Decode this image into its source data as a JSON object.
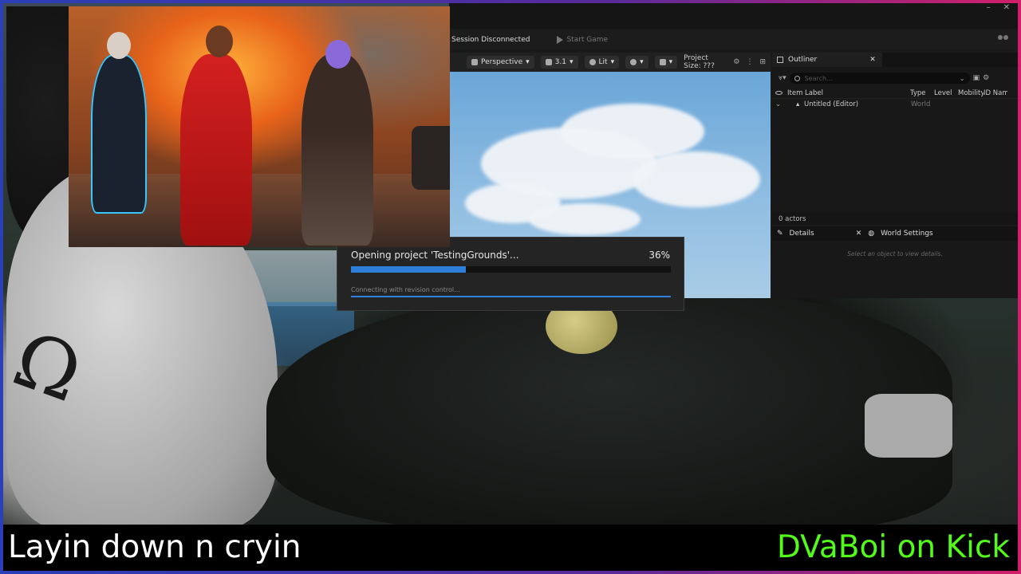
{
  "editor": {
    "topbar": {
      "session": "Session Disconnected",
      "start_game": "Start Game"
    },
    "viewport_toolbar": {
      "perspective": "Perspective",
      "speed": "3.1",
      "lit": "Lit",
      "project_size": "Project Size: ???"
    },
    "outliner": {
      "tab": "Outliner",
      "search_placeholder": "Search...",
      "columns": [
        "Item Label",
        "Type",
        "Level",
        "Mobility",
        "ID Name"
      ],
      "rows": [
        {
          "label": "Untitled (Editor)",
          "type": "World"
        }
      ],
      "actors": "0 actors"
    },
    "details": {
      "tab_details": "Details",
      "tab_world": "World Settings",
      "hint": "Select an object to view details."
    }
  },
  "dialog": {
    "title": "Opening project 'TestingGrounds'...",
    "percent_label": "36%",
    "progress": 0.36,
    "status": "Connecting with revision control..."
  },
  "overlay": {
    "caption": "Layin down n cryin",
    "channel": "DVaBoi on Kick",
    "channel_color": "#53fc18",
    "accent": "#2d7fd8"
  }
}
